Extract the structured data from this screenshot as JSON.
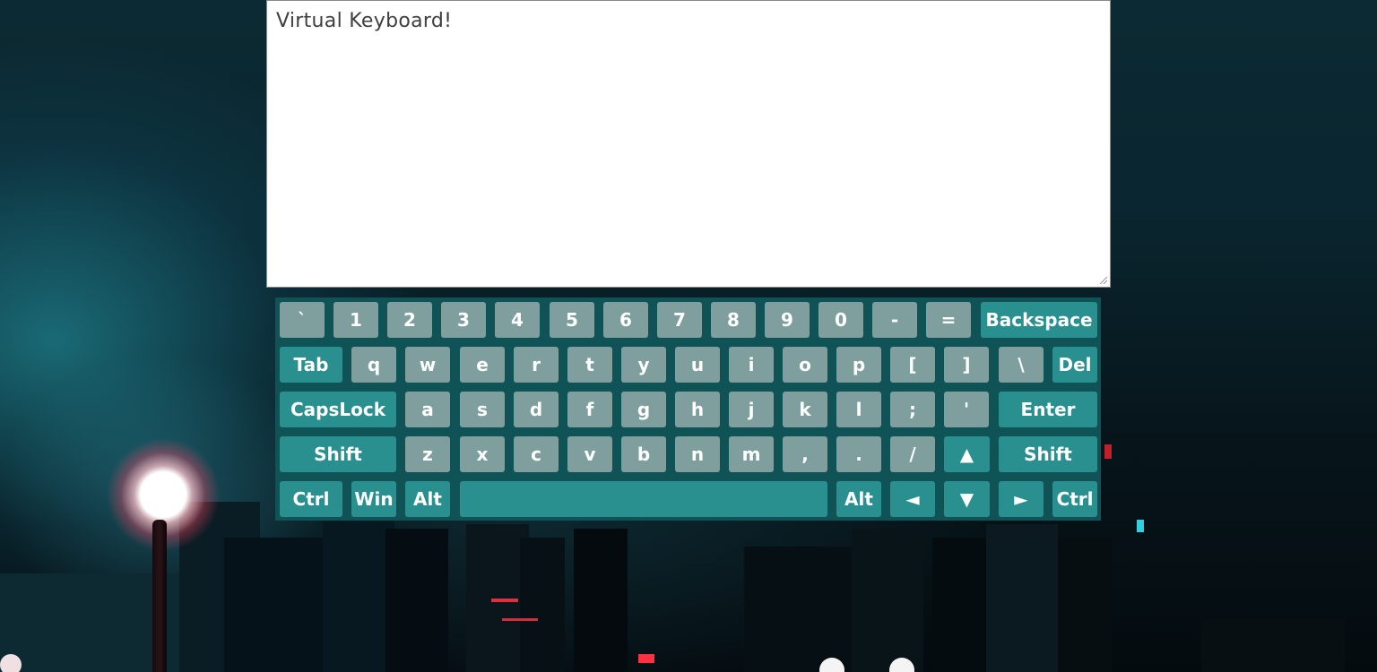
{
  "textarea": {
    "value": "Virtual Keyboard!"
  },
  "colors": {
    "char_key": "#7f9f9f",
    "function_key": "#2a8f8f",
    "keyboard_bg": "#0f5356"
  },
  "rows": [
    [
      {
        "label": "`",
        "type": "char",
        "name": "key-backtick"
      },
      {
        "label": "1",
        "type": "char",
        "name": "key-1"
      },
      {
        "label": "2",
        "type": "char",
        "name": "key-2"
      },
      {
        "label": "3",
        "type": "char",
        "name": "key-3"
      },
      {
        "label": "4",
        "type": "char",
        "name": "key-4"
      },
      {
        "label": "5",
        "type": "char",
        "name": "key-5"
      },
      {
        "label": "6",
        "type": "char",
        "name": "key-6"
      },
      {
        "label": "7",
        "type": "char",
        "name": "key-7"
      },
      {
        "label": "8",
        "type": "char",
        "name": "key-8"
      },
      {
        "label": "9",
        "type": "char",
        "name": "key-9"
      },
      {
        "label": "0",
        "type": "char",
        "name": "key-0"
      },
      {
        "label": "-",
        "type": "char",
        "name": "key-minus"
      },
      {
        "label": "=",
        "type": "char",
        "name": "key-equals"
      },
      {
        "label": "Backspace",
        "type": "fn",
        "name": "key-backspace"
      }
    ],
    [
      {
        "label": "Tab",
        "type": "fn",
        "name": "key-tab"
      },
      {
        "label": "q",
        "type": "char",
        "name": "key-q"
      },
      {
        "label": "w",
        "type": "char",
        "name": "key-w"
      },
      {
        "label": "e",
        "type": "char",
        "name": "key-e"
      },
      {
        "label": "r",
        "type": "char",
        "name": "key-r"
      },
      {
        "label": "t",
        "type": "char",
        "name": "key-t"
      },
      {
        "label": "y",
        "type": "char",
        "name": "key-y"
      },
      {
        "label": "u",
        "type": "char",
        "name": "key-u"
      },
      {
        "label": "i",
        "type": "char",
        "name": "key-i"
      },
      {
        "label": "o",
        "type": "char",
        "name": "key-o"
      },
      {
        "label": "p",
        "type": "char",
        "name": "key-p"
      },
      {
        "label": "[",
        "type": "char",
        "name": "key-open-bracket"
      },
      {
        "label": "]",
        "type": "char",
        "name": "key-close-bracket"
      },
      {
        "label": "\\",
        "type": "char",
        "name": "key-backslash"
      },
      {
        "label": "Del",
        "type": "fn",
        "name": "key-del"
      }
    ],
    [
      {
        "label": "CapsLock",
        "type": "fn",
        "name": "key-capslock"
      },
      {
        "label": "a",
        "type": "char",
        "name": "key-a"
      },
      {
        "label": "s",
        "type": "char",
        "name": "key-s"
      },
      {
        "label": "d",
        "type": "char",
        "name": "key-d"
      },
      {
        "label": "f",
        "type": "char",
        "name": "key-f"
      },
      {
        "label": "g",
        "type": "char",
        "name": "key-g"
      },
      {
        "label": "h",
        "type": "char",
        "name": "key-h"
      },
      {
        "label": "j",
        "type": "char",
        "name": "key-j"
      },
      {
        "label": "k",
        "type": "char",
        "name": "key-k"
      },
      {
        "label": "l",
        "type": "char",
        "name": "key-l"
      },
      {
        "label": ";",
        "type": "char",
        "name": "key-semicolon"
      },
      {
        "label": "'",
        "type": "char",
        "name": "key-quote"
      },
      {
        "label": "Enter",
        "type": "fn",
        "name": "key-enter"
      }
    ],
    [
      {
        "label": "Shift",
        "type": "fn",
        "name": "key-shift-left"
      },
      {
        "label": "z",
        "type": "char",
        "name": "key-z"
      },
      {
        "label": "x",
        "type": "char",
        "name": "key-x"
      },
      {
        "label": "c",
        "type": "char",
        "name": "key-c"
      },
      {
        "label": "v",
        "type": "char",
        "name": "key-v"
      },
      {
        "label": "b",
        "type": "char",
        "name": "key-b"
      },
      {
        "label": "n",
        "type": "char",
        "name": "key-n"
      },
      {
        "label": "m",
        "type": "char",
        "name": "key-m"
      },
      {
        "label": ",",
        "type": "char",
        "name": "key-comma"
      },
      {
        "label": ".",
        "type": "char",
        "name": "key-period"
      },
      {
        "label": "/",
        "type": "char",
        "name": "key-slash"
      },
      {
        "label": "▲",
        "type": "fn",
        "name": "key-arrow-up"
      },
      {
        "label": "Shift",
        "type": "fn",
        "name": "key-shift-right"
      }
    ],
    [
      {
        "label": "Ctrl",
        "type": "fn",
        "name": "key-ctrl-left"
      },
      {
        "label": "Win",
        "type": "fn",
        "name": "key-win"
      },
      {
        "label": "Alt",
        "type": "fn",
        "name": "key-alt-left"
      },
      {
        "label": "",
        "type": "fn",
        "name": "key-space"
      },
      {
        "label": "Alt",
        "type": "fn",
        "name": "key-alt-right"
      },
      {
        "label": "◄",
        "type": "fn",
        "name": "key-arrow-left"
      },
      {
        "label": "▼",
        "type": "fn",
        "name": "key-arrow-down"
      },
      {
        "label": "►",
        "type": "fn",
        "name": "key-arrow-right"
      },
      {
        "label": "Ctrl",
        "type": "fn",
        "name": "key-ctrl-right"
      }
    ]
  ]
}
